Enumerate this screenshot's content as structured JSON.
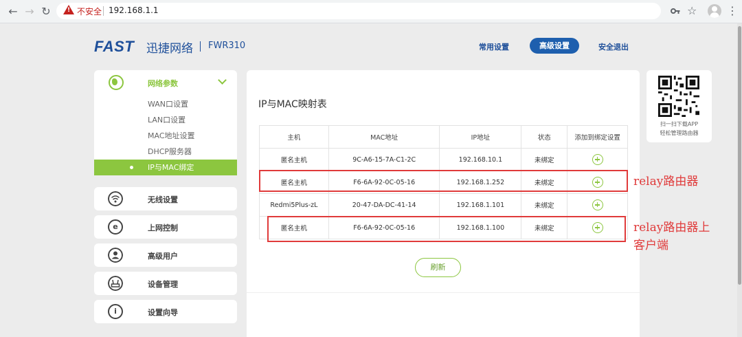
{
  "browser": {
    "security_label": "不安全",
    "url": "192.168.1.1"
  },
  "header": {
    "logo": "FAST",
    "brand": "迅捷网络",
    "model": "FWR310",
    "nav": [
      "常用设置",
      "高级设置",
      "安全退出"
    ],
    "active_nav": "高级设置"
  },
  "sidebar": {
    "group": {
      "label": "网络参数",
      "items": [
        "WAN口设置",
        "LAN口设置",
        "MAC地址设置",
        "DHCP服务器",
        "IP与MAC绑定"
      ],
      "active_item": "IP与MAC绑定"
    },
    "items": [
      "无线设置",
      "上网控制",
      "高级用户",
      "设备管理",
      "设置向导"
    ]
  },
  "main": {
    "title": "IP与MAC映射表",
    "columns": [
      "主机",
      "MAC地址",
      "IP地址",
      "状态",
      "添加到绑定设置"
    ],
    "rows": [
      {
        "host": "匿名主机",
        "mac": "9C-A6-15-7A-C1-2C",
        "ip": "192.168.10.1",
        "status": "未绑定"
      },
      {
        "host": "匿名主机",
        "mac": "F6-6A-92-0C-05-16",
        "ip": "192.168.1.252",
        "status": "未绑定"
      },
      {
        "host": "Redmi5Plus-zL",
        "mac": "20-47-DA-DC-41-14",
        "ip": "192.168.1.101",
        "status": "未绑定"
      },
      {
        "host": "匿名主机",
        "mac": "F6-6A-92-0C-05-16",
        "ip": "192.168.1.100",
        "status": "未绑定"
      }
    ],
    "refresh_label": "刷新"
  },
  "qr": {
    "line1": "扫一扫下载APP",
    "line2": "轻松管理路由器"
  },
  "annotations": {
    "note1": "relay路由器",
    "note2_line1": "relay路由器上",
    "note2_line2": "客户端",
    "color": "#e03a3a"
  },
  "colors": {
    "brand_blue": "#1e4f9a",
    "accent_green": "#8cc63f"
  }
}
